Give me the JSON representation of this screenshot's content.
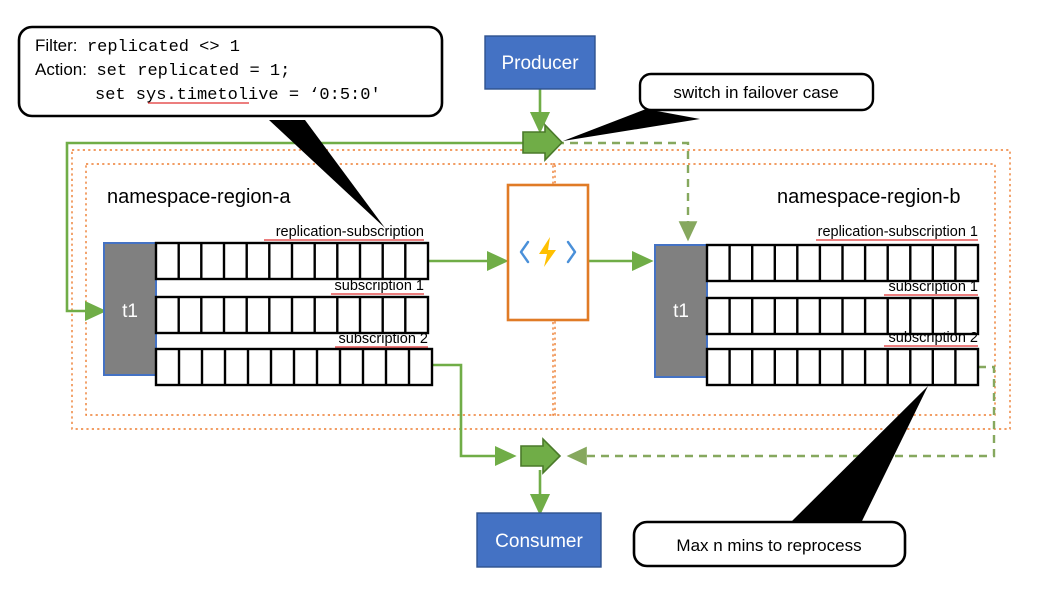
{
  "diagram": {
    "title": "Azure Service Bus geo-replication failover diagram",
    "colors": {
      "node_blue_fill": "#4472C4",
      "node_blue_stroke": "#2F528F",
      "topic_gray_fill": "#808080",
      "topic_blue_stroke": "#4472C4",
      "arrow_green": "#70AD47",
      "flow_green": "#70AD47",
      "container_orange": "#ED7D31",
      "function_orange": "#E07B26",
      "bolt_yellow": "#FFC000",
      "bracket_blue": "#4A90D9",
      "callout_black": "#000000",
      "spellcheck_red": "#E03030"
    }
  },
  "callouts": {
    "filter_action": {
      "name": "filter-action-callout",
      "line1_label": "Filter:",
      "line1_code": "replicated <> 1",
      "line2_label": "Action:",
      "line2_code": "set replicated = 1;",
      "line3_code": "set sys.timetolive = ‘0:5:0'"
    },
    "switch_failover": {
      "name": "switch-failover-callout",
      "text": "switch in failover case"
    },
    "max_reprocess": {
      "name": "max-reprocess-callout",
      "text": "Max n mins to reprocess"
    }
  },
  "nodes": {
    "producer": {
      "label": "Producer"
    },
    "consumer": {
      "label": "Consumer"
    },
    "function": {
      "label": "",
      "icon": "azure-function-icon"
    }
  },
  "namespaces": [
    {
      "id": "region-a",
      "title": "namespace-region-a",
      "topic": "t1",
      "subscriptions": [
        {
          "label": "replication-subscription",
          "cells": 12
        },
        {
          "label": "subscription 1",
          "cells": 12
        },
        {
          "label": "subscription 2",
          "cells": 12
        }
      ]
    },
    {
      "id": "region-b",
      "title": "namespace-region-b",
      "topic": "t1",
      "subscriptions": [
        {
          "label": "replication-subscription 1",
          "cells": 12
        },
        {
          "label": "subscription 1",
          "cells": 12
        },
        {
          "label": "subscription 2",
          "cells": 12
        }
      ]
    }
  ],
  "connectors": {
    "producer_to_switch": "solid-green-down",
    "switch_to_region_a": "solid-green-left-loop",
    "switch_to_region_b": "dashed-green-right-loop",
    "region_a_to_function": "solid-green-right",
    "function_to_region_b": "solid-green-right",
    "region_a_sub2_to_consumer_switch": "solid-green-down",
    "region_b_sub2_to_consumer_switch": "dashed-green-left-loop",
    "consumer_switch_to_consumer": "solid-green-down"
  },
  "arrow_switches": {
    "top": {
      "name": "top-failover-switch-arrow",
      "direction": "right"
    },
    "bottom": {
      "name": "bottom-failover-switch-arrow",
      "direction": "right"
    }
  }
}
